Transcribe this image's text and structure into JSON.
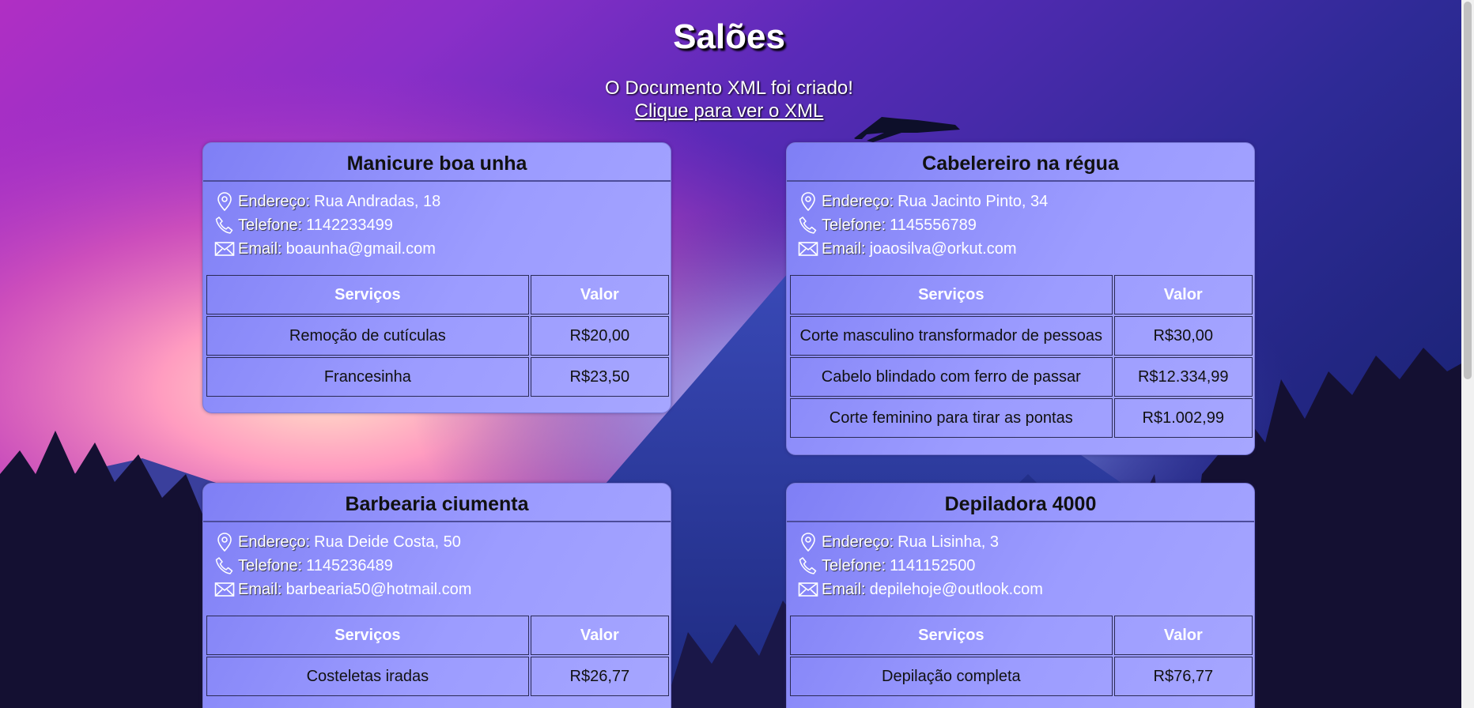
{
  "page": {
    "title": "Salões",
    "xml_message": "O Documento XML foi criado!",
    "xml_link": "Clique para ver o XML"
  },
  "labels": {
    "address": "Endereço:",
    "phone": "Telefone:",
    "email": "Email:",
    "services_header": "Serviços",
    "value_header": "Valor"
  },
  "salons": [
    {
      "name": "Manicure boa unha",
      "address": "Rua Andradas, 18",
      "phone": "1142233499",
      "email": "boaunha@gmail.com",
      "services": [
        {
          "service": "Remoção de cutículas",
          "value": "R$20,00"
        },
        {
          "service": "Francesinha",
          "value": "R$23,50"
        }
      ]
    },
    {
      "name": "Cabelereiro na régua",
      "address": "Rua Jacinto Pinto, 34",
      "phone": "1145556789",
      "email": "joaosilva@orkut.com",
      "services": [
        {
          "service": "Corte masculino transformador de pessoas",
          "value": "R$30,00"
        },
        {
          "service": "Cabelo blindado com ferro de passar",
          "value": "R$12.334,99"
        },
        {
          "service": "Corte feminino para tirar as pontas",
          "value": "R$1.002,99"
        }
      ]
    },
    {
      "name": "Barbearia ciumenta",
      "address": "Rua Deide Costa, 50",
      "phone": "1145236489",
      "email": "barbearia50@hotmail.com",
      "services": [
        {
          "service": "Costeletas iradas",
          "value": "R$26,77"
        }
      ]
    },
    {
      "name": "Depiladora 4000",
      "address": "Rua Lisinha, 3",
      "phone": "1141152500",
      "email": "depilehoje@outlook.com",
      "services": [
        {
          "service": "Depilação completa",
          "value": "R$76,77"
        }
      ]
    }
  ],
  "icons": {
    "address": "location-pin-icon",
    "phone": "phone-icon",
    "email": "envelope-icon"
  },
  "colors": {
    "card_background": "#9c9cff",
    "card_title_text": "#111111",
    "page_text": "#ffffff"
  }
}
